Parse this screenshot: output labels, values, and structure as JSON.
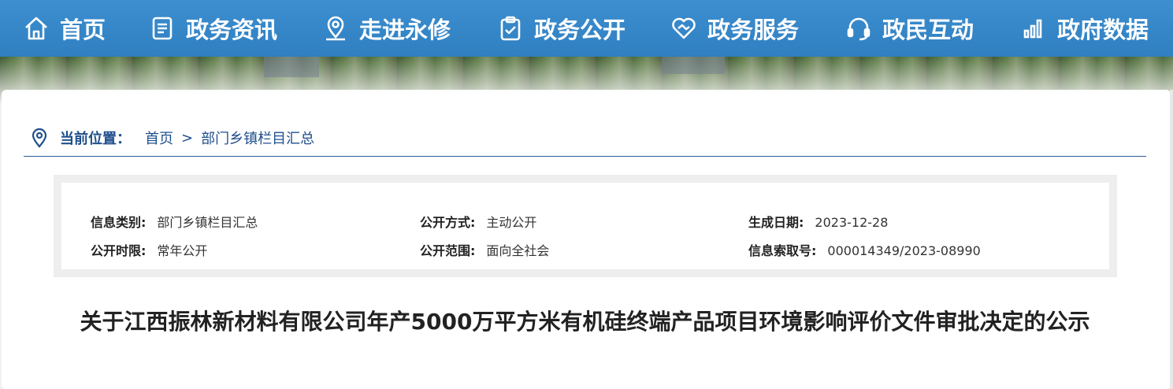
{
  "nav": {
    "items": [
      {
        "label": "首页",
        "icon": "home-icon"
      },
      {
        "label": "政务资讯",
        "icon": "document-icon"
      },
      {
        "label": "走进永修",
        "icon": "location-icon"
      },
      {
        "label": "政务公开",
        "icon": "clipboard-check-icon"
      },
      {
        "label": "政务服务",
        "icon": "handshake-heart-icon"
      },
      {
        "label": "政民互动",
        "icon": "headset-icon"
      },
      {
        "label": "政府数据",
        "icon": "bar-chart-icon"
      }
    ],
    "color": "#3389cc"
  },
  "breadcrumb": {
    "label": "当前位置：",
    "home": "首页",
    "separator": ">",
    "current": "部门乡镇栏目汇总"
  },
  "meta": {
    "category_key": "信息类别:",
    "category_val": "部门乡镇栏目汇总",
    "method_key": "公开方式:",
    "method_val": "主动公开",
    "date_key": "生成日期:",
    "date_val": "2023-12-28",
    "period_key": "公开时限:",
    "period_val": "常年公开",
    "scope_key": "公开范围:",
    "scope_val": "面向全社会",
    "index_key": "信息索取号:",
    "index_val": "000014349/2023-08990"
  },
  "article": {
    "title": "关于江西振林新材料有限公司年产5000万平方米有机硅终端产品项目环境影响评价文件审批决定的公示"
  }
}
